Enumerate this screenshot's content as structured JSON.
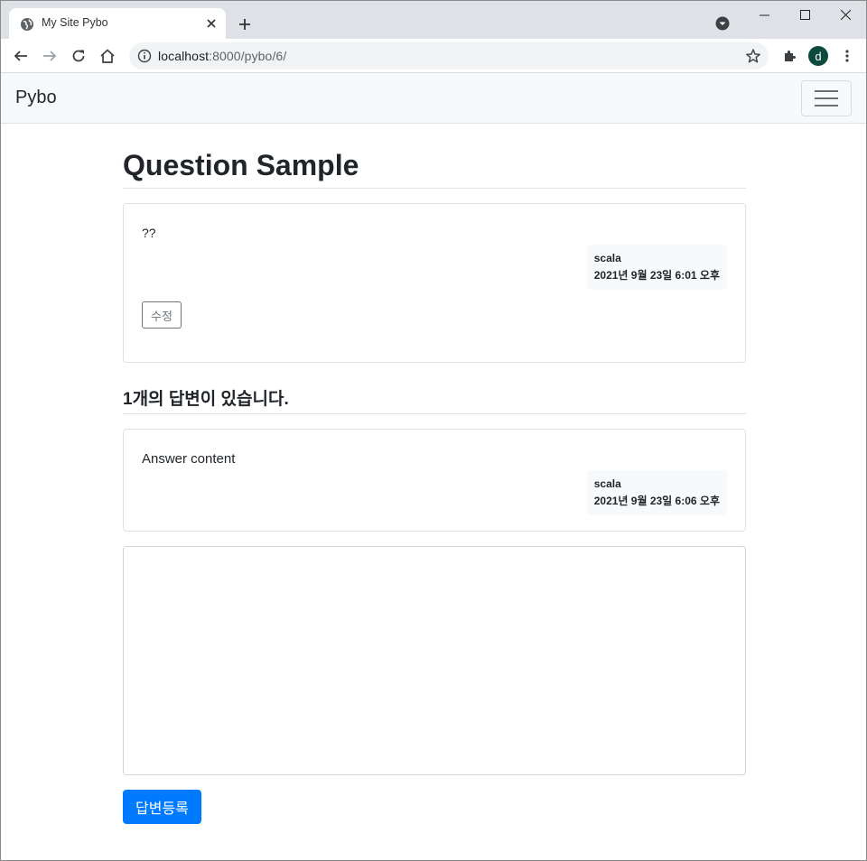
{
  "browser": {
    "tab_title": "My Site Pybo",
    "url_host": "localhost",
    "url_rest": ":8000/pybo/6/",
    "profile_initial": "d"
  },
  "navbar": {
    "brand": "Pybo"
  },
  "question": {
    "subject": "Question Sample",
    "content": "??",
    "author": "scala",
    "date": "2021년 9월 23일 6:01 오후",
    "edit_label": "수정"
  },
  "answers": {
    "count": "1",
    "count_suffix": "개의 답변이 있습니다.",
    "items": [
      {
        "content": "Answer content",
        "author": "scala",
        "date": "2021년 9월 23일 6:06 오후"
      }
    ]
  },
  "form": {
    "textarea_value": "",
    "submit_label": "답변등록"
  },
  "colors": {
    "primary": "#007bff",
    "secondary": "#6c757d",
    "navbar_bg": "#f8f9fa"
  }
}
